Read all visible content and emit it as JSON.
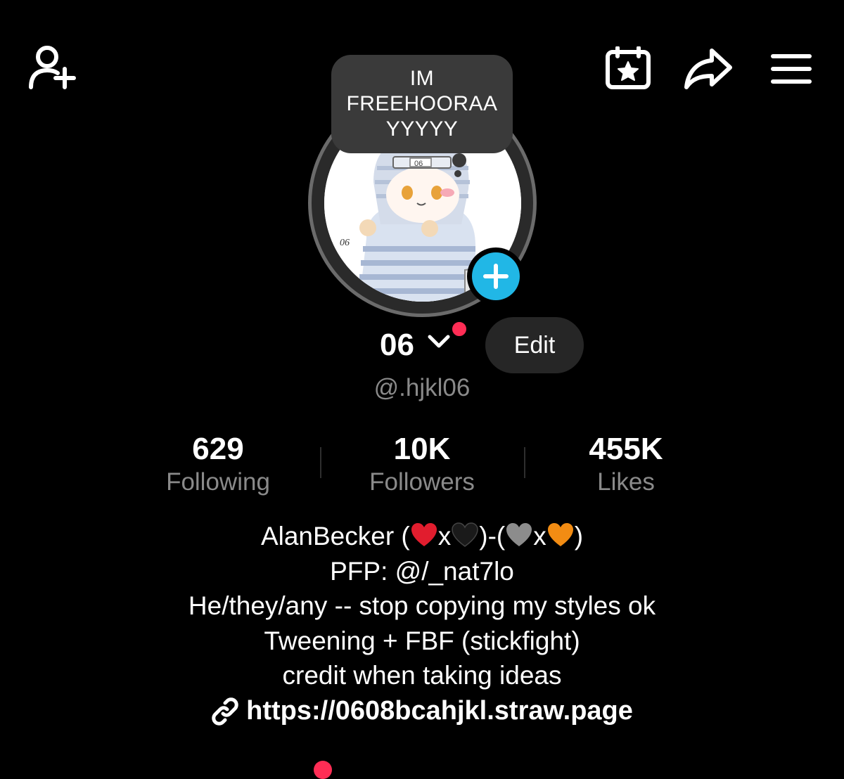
{
  "header": {
    "add_friend_icon": "person-plus-icon",
    "calendar_icon": "calendar-star-icon",
    "share_icon": "share-arrow-icon",
    "menu_icon": "hamburger-menu-icon"
  },
  "avatar": {
    "note_text": "IM FREEHOORAA YYYYY",
    "artwork_label": "06",
    "add_badge_icon": "plus-icon"
  },
  "profile": {
    "display_name": "06",
    "edit_label": "Edit",
    "handle": "@.hjkl06"
  },
  "stats": [
    {
      "value": "629",
      "label": "Following"
    },
    {
      "value": "10K",
      "label": "Followers"
    },
    {
      "value": "455K",
      "label": "Likes"
    }
  ],
  "bio": {
    "line1_prefix": "AlanBecker (",
    "line1_x1": "x",
    "line1_mid": ")-(",
    "line1_x2": "x",
    "line1_suffix": ")",
    "hearts": [
      "red",
      "black",
      "grey",
      "orange"
    ],
    "line2": "PFP: @/_nat7lo",
    "line3": "He/they/any -- stop copying my styles ok",
    "line4": "Tweening + FBF (stickfight)",
    "line5": "credit when taking ideas"
  },
  "link": {
    "url": "https://0608bcahjkl.straw.page",
    "icon": "link-icon"
  },
  "colors": {
    "background": "#000000",
    "accent_blue": "#21b7e6",
    "notification_red": "#ff2d55",
    "muted_text": "#8a8a8a"
  }
}
